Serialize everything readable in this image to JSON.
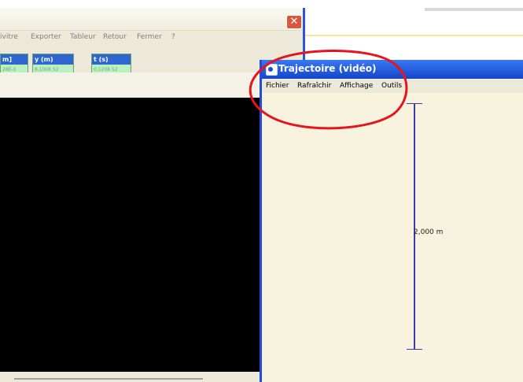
{
  "back_window": {
    "close_glyph": "✕",
    "menu": [
      "ivitre",
      "Exporter",
      "Tableur",
      "Retour",
      "Fermer",
      "?"
    ],
    "fields": [
      {
        "head": "m]",
        "value": "28E-0"
      },
      {
        "head": "y (m)",
        "value": "8,1008 52"
      },
      {
        "head": "t (s)",
        "value": "0,1208 52"
      }
    ]
  },
  "front_window": {
    "title": "Trajectoire (vidéo)",
    "icon": "app-window-icon",
    "menu": [
      "Fichier",
      "Rafraîchir",
      "Affichage",
      "Outils"
    ],
    "scale_label": "2,000 m"
  },
  "annotation": {
    "color": "#e8141b"
  },
  "colors": {
    "titlebar_blue": "#1f4fd6",
    "field_green": "#b9f2c0",
    "close_red": "#d9573b"
  }
}
